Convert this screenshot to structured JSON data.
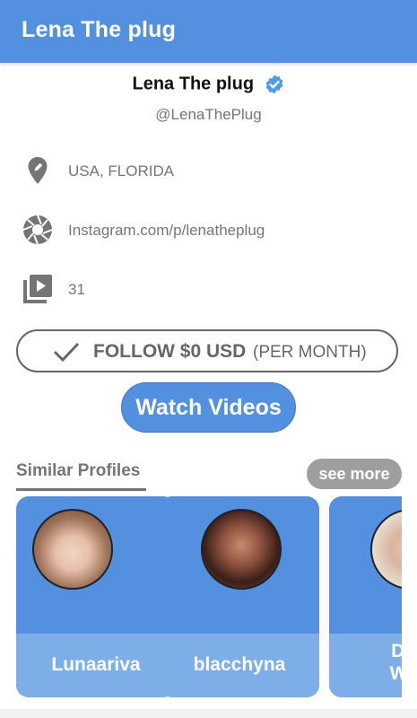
{
  "appbar": {
    "title": "Lena The plug"
  },
  "profile": {
    "name": "Lena The plug",
    "handle": "@LenaThePlug",
    "location": "USA, FLORIDA",
    "instagram": "Instagram.com/p/lenatheplug",
    "video_count": "31",
    "verified_icon": "verified-badge-icon"
  },
  "follow": {
    "main": "FOLLOW $0 USD",
    "sub": "(PER MONTH)"
  },
  "watch_label": "Watch Videos",
  "similar": {
    "title": "Similar Profiles",
    "see_more": "see more",
    "cards": [
      {
        "name": "Lunaariva"
      },
      {
        "name": "blacchyna"
      },
      {
        "name_line1": "Dan",
        "name_line2": "Wes"
      }
    ]
  },
  "colors": {
    "accent": "#5390e0",
    "card_footer": "#7eaee8",
    "muted": "#757575"
  }
}
